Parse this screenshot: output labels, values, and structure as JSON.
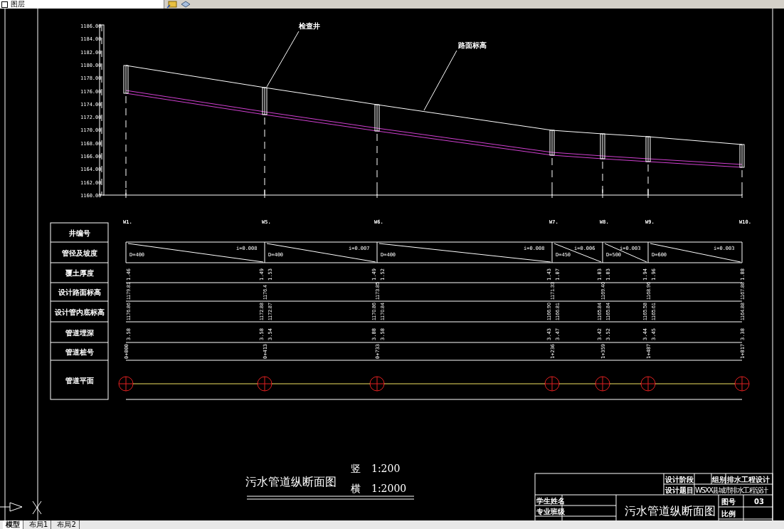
{
  "toolbar": {
    "layer_dropdown": "图层"
  },
  "elevation_labels": [
    "1186.00",
    "1184.00",
    "1182.00",
    "1180.00",
    "1178.00",
    "1176.00",
    "1174.00",
    "1172.00",
    "1170.00",
    "1168.00",
    "1166.00",
    "1164.00",
    "1162.00",
    "1160.00"
  ],
  "callouts": [
    "检查井",
    "路面标高"
  ],
  "row_labels": [
    "井编号",
    "管径及坡度",
    "覆土厚度",
    "设计路面标高",
    "设计管内底标高",
    "管道埋深",
    "管道桩号",
    "管道平面"
  ],
  "wells": [
    {
      "label": "W1.",
      "cover": [
        "1.46"
      ],
      "ground": "1179.81",
      "invert": [
        "1176.86"
      ],
      "depth": [
        "3.58"
      ],
      "station": "0+000"
    },
    {
      "label": "W5.",
      "cover": [
        "1.49",
        "1.53"
      ],
      "ground": "1176.4",
      "invert": [
        "1172.88",
        "1172.87"
      ],
      "depth": [
        "3.58",
        "3.54"
      ],
      "station": "0+413"
    },
    {
      "label": "W6.",
      "cover": [
        "1.49",
        "1.52"
      ],
      "ground": "1173.85",
      "invert": [
        "1170.86",
        "1170.84"
      ],
      "depth": [
        "3.88",
        "3.58"
      ],
      "station": "0+733"
    },
    {
      "label": "W7.",
      "cover": [
        "1.43",
        "1.07"
      ],
      "ground": "1171.33",
      "invert": [
        "1166.90",
        "1166.81"
      ],
      "depth": [
        "3.43",
        "3.47"
      ],
      "station": "1+236"
    },
    {
      "label": "W8.",
      "cover": [
        "1.03",
        "1.03"
      ],
      "ground": "1169.40",
      "invert": [
        "1165.84",
        "1165.84"
      ],
      "depth": [
        "3.42",
        "3.52"
      ],
      "station": "1+359"
    },
    {
      "label": "W9.",
      "cover": [
        "1.94",
        "1.96"
      ],
      "ground": "1168.96",
      "invert": [
        "1165.58",
        "1165.61"
      ],
      "depth": [
        "3.44",
        "3.45"
      ],
      "station": "1+487"
    },
    {
      "label": "W10.",
      "cover": [
        "1.88"
      ],
      "ground": "1167.88",
      "invert": [
        "1164.88"
      ],
      "depth": [
        "3.38"
      ],
      "station": "1+817"
    }
  ],
  "segments": [
    {
      "diameter": "D=400",
      "slope": "i=0.008"
    },
    {
      "diameter": "D=400",
      "slope": "i=0.007"
    },
    {
      "diameter": "D=400",
      "slope": "i=0.008"
    },
    {
      "diameter": "D=450",
      "slope": "i=0.006"
    },
    {
      "diameter": "D=500",
      "slope": "i=0.003"
    },
    {
      "diameter": "D=600",
      "slope": "i=0.003"
    }
  ],
  "title": {
    "name": "污水管道纵断面图",
    "vertical_label": "竖",
    "vertical_scale": "1:200",
    "horizontal_label": "横",
    "horizontal_scale": "1:2000"
  },
  "title_block": {
    "stage_label": "设计阶段",
    "group_label": "组别",
    "group_value": "排水工程设计",
    "topic_label": "设计题目",
    "topic_value": "WSXX县城市排水工程设计",
    "student_label": "学生姓名",
    "class_label": "专业班级",
    "drawing_title": "污水管道纵断面图",
    "number_label": "图号",
    "number_value": "03",
    "scale_label": "比例"
  },
  "tabs": [
    {
      "label": "模型",
      "selected": true
    },
    {
      "label": "布局1",
      "selected": false
    },
    {
      "label": "布局2",
      "selected": false
    }
  ]
}
